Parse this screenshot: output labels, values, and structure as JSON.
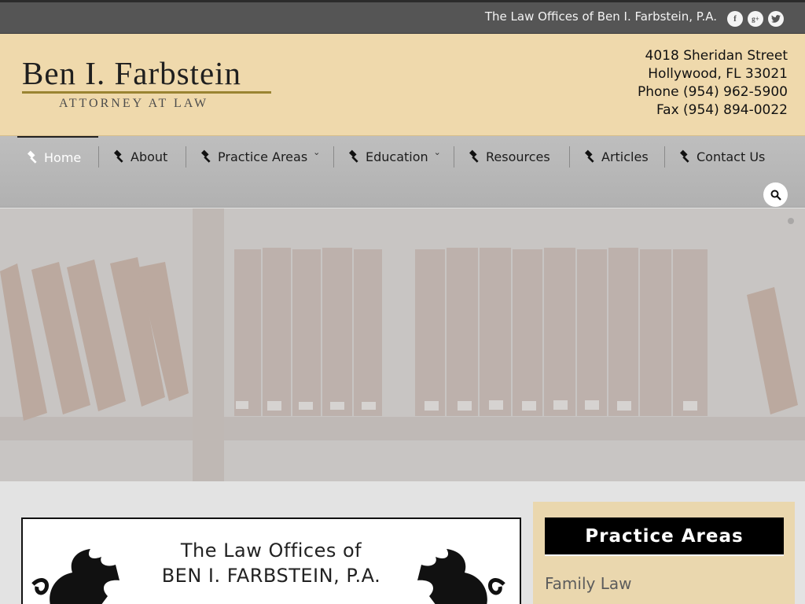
{
  "topbar": {
    "title": "The Law Offices of Ben I. Farbstein, P.A.",
    "social": [
      {
        "icon": "facebook-icon",
        "glyph": "f"
      },
      {
        "icon": "google-plus-icon",
        "glyph": "g+"
      },
      {
        "icon": "twitter-icon",
        "glyph": "t"
      }
    ]
  },
  "header": {
    "logo_name": "Ben I. Farbstein",
    "logo_subtitle": "ATTORNEY AT LAW",
    "address": {
      "street": "4018 Sheridan Street",
      "city": "Hollywood, FL 33021",
      "phone": "Phone (954) 962-5900",
      "fax": "Fax (954) 894-0022"
    }
  },
  "nav": {
    "items": [
      {
        "label": "Home",
        "active": true
      },
      {
        "label": "About"
      },
      {
        "label": "Practice Areas",
        "dropdown": true
      },
      {
        "label": "Education",
        "dropdown": true
      },
      {
        "label": "Resources"
      },
      {
        "label": "Articles"
      },
      {
        "label": "Contact Us"
      }
    ],
    "caret": "⌄"
  },
  "content": {
    "heading_line1": "The Law Offices of",
    "heading_line2": "BEN I. FARBSTEIN, P.A."
  },
  "sidebar": {
    "heading": "Practice Areas",
    "links": [
      "Family Law"
    ]
  },
  "colors": {
    "topbar": "#555555",
    "header": "#efd9ac",
    "nav": "#b8b8b8",
    "logo_rule": "#9a8432",
    "sidebar": "#ead7ae"
  }
}
